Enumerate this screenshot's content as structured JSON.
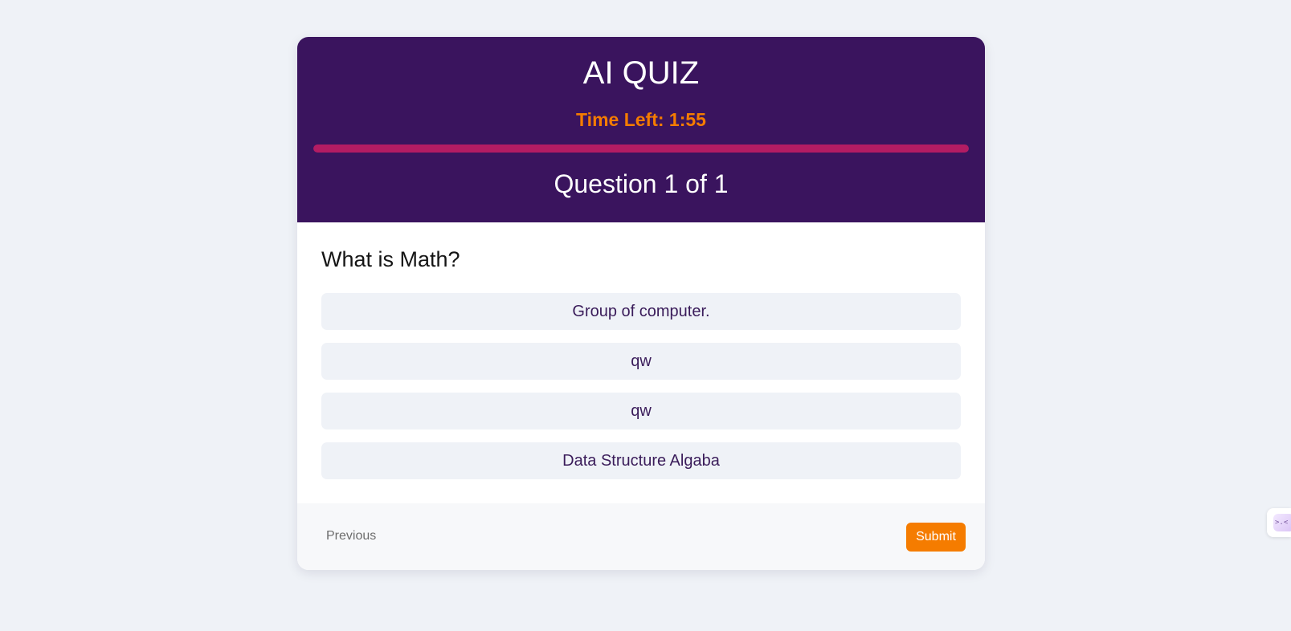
{
  "header": {
    "title": "AI QUIZ",
    "timer_text": "Time Left: 1:55",
    "time_progress_fraction": 1.0,
    "question_counter": "Question 1 of 1"
  },
  "question": {
    "text": "What is Math?",
    "options": [
      "Group of computer.",
      "qw",
      "qw",
      "Data Structure Algaba"
    ]
  },
  "footer": {
    "previous_label": "Previous",
    "submit_label": "Submit"
  },
  "widget": {
    "icon_name": "assistant-face-icon",
    "glyph": ">.<"
  },
  "colors": {
    "page_background": "#eff2f7",
    "header_background": "#3a145e",
    "timer": "#f57c00",
    "progress_bar": "#b31c63",
    "option_background": "#eff2f7",
    "option_text": "#3a1c5a",
    "submit_background": "#f57c00"
  }
}
